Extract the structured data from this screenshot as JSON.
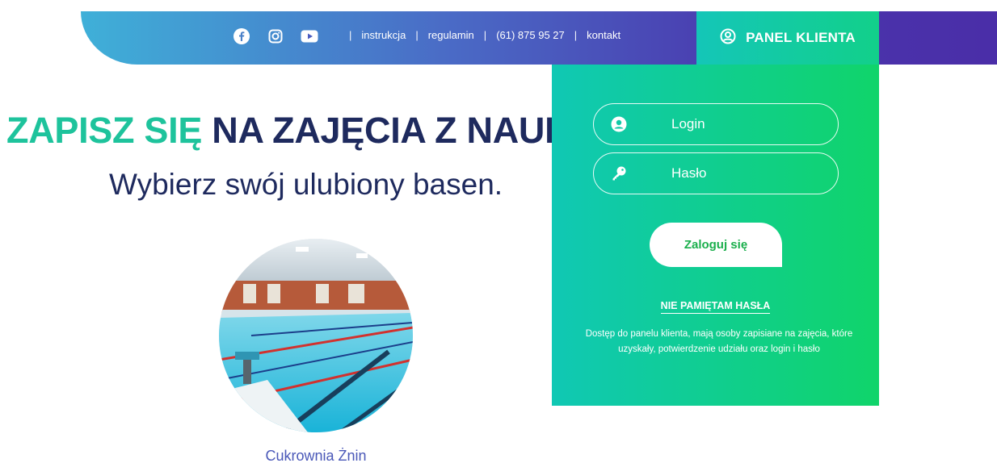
{
  "topbar": {
    "social": [
      {
        "name": "facebook-icon"
      },
      {
        "name": "instagram-icon"
      },
      {
        "name": "youtube-icon"
      }
    ],
    "links": {
      "instrukcja": "instrukcja",
      "regulamin": "regulamin",
      "phone": "(61) 875 95 27",
      "kontakt": "kontakt"
    },
    "separator": "|"
  },
  "panel": {
    "tab_label": "PANEL KLIENTA",
    "login_placeholder": "Login",
    "password_placeholder": "Hasło",
    "submit_label": "Zaloguj się",
    "forgot_label": "NIE PAMIĘTAM HASŁA",
    "note": "Dostęp do panelu klienta, mają osoby zapisiane na zajęcia, które uzyskały, potwierdzenie udziału oraz login i hasło"
  },
  "hero": {
    "headline_part1": "ZAPISZ SIĘ",
    "headline_part2": " NA ZAJĘCIA Z NAUKI PŁYWANIA",
    "subheadline": "Wybierz swój ulubiony basen."
  },
  "pools": [
    {
      "caption": "Cukrownia Żnin"
    }
  ],
  "colors": {
    "accent_green": "#1ec39c",
    "navy": "#1e2a5e",
    "panel_green": "#12d08a",
    "topbar_purple": "#4a2ea8",
    "topbar_blue": "#3fb0d8"
  }
}
